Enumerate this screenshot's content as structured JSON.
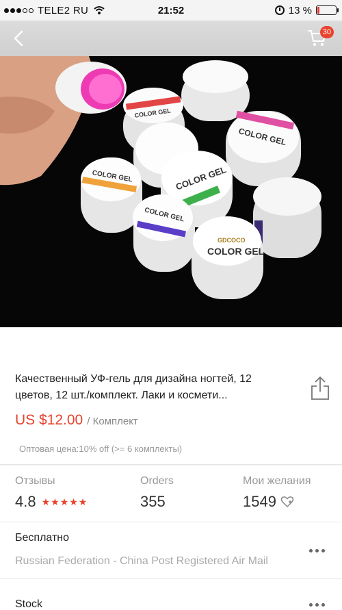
{
  "status_bar": {
    "carrier": "TELE2 RU",
    "time": "21:52",
    "battery": "13 %",
    "battery_level": 0.13,
    "signal_filled": 3,
    "signal_total": 5
  },
  "nav": {
    "cart_count": "30",
    "accent": "#e8432e"
  },
  "product": {
    "image_texts": {
      "color_gel": "COLOR GEL",
      "brand": "GDCOCO"
    },
    "title": "Качественный УФ-гель для дизайна ногтей, 12 цветов, 12 шт./комплект. Лаки и космети...",
    "price": "US $12.00",
    "unit": "/ Комплект",
    "wholesale": "Оптовая цена:10% off (>= 6 комплекты)"
  },
  "stats": {
    "reviews_label": "Отзывы",
    "rating": "4.8",
    "stars": "★★★★★",
    "orders_label": "Orders",
    "orders": "355",
    "wishlist_label": "Мои желания",
    "wishlist": "1549"
  },
  "shipping": {
    "title": "Бесплатно",
    "method": "Russian Federation - China Post Registered Air Mail"
  },
  "stock": {
    "label": "Stock"
  }
}
